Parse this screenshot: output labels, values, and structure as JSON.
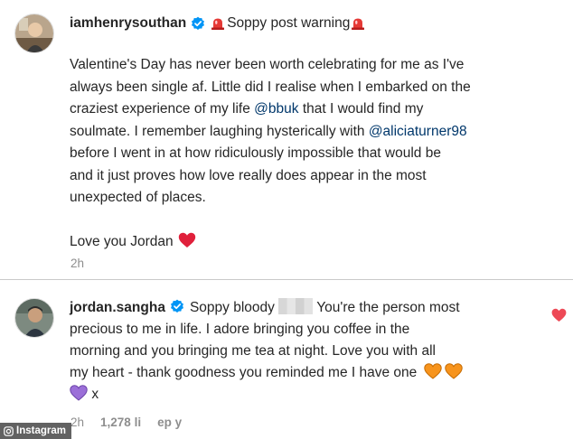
{
  "post": {
    "username": "iamhenrysouthan",
    "header_text": "Soppy post warning",
    "lines": [
      "Valentine's Day has never been worth celebrating for me as I've",
      "always been single af. Little did I realise when I embarked on the",
      "craziest experience of my life ",
      "@bbuk",
      " that I would find my",
      "soulmate. I remember laughing hysterically with ",
      "@aliciaturner98",
      "before I went in at how ridiculously impossible that would be",
      "and it just proves how love really does appear in the most",
      "unexpected of places."
    ],
    "signoff": "Love you Jordan",
    "time": "2h"
  },
  "comment": {
    "username": "jordan.sangha",
    "first_text": "Soppy bloody",
    "first_rest": " You're the person most",
    "line2": "precious to me in life. I adore bringing you coffee in the",
    "line3": "morning and you bringing me tea at night. Love you with all",
    "line4": "my heart - thank goodness you reminded me I have one",
    "line5_suffix": "x",
    "time": "2h",
    "likes": "1,278 li",
    "reply": "ep y"
  },
  "watermark": {
    "label": "Instagram"
  },
  "colors": {
    "text": "#262626",
    "secondary": "#8e8e8e",
    "mention": "#00376b",
    "verified": "#0095f6",
    "red_heart": "#e0203b",
    "orange_heart": "#f7941d",
    "purple_heart": "#9b6fd8",
    "like_red": "#ed4956"
  },
  "icons": [
    "verified-badge-icon",
    "siren-icon",
    "red-heart-emoji",
    "orange-heart-emoji",
    "purple-heart-emoji",
    "like-heart-icon",
    "instagram-logo-icon"
  ]
}
